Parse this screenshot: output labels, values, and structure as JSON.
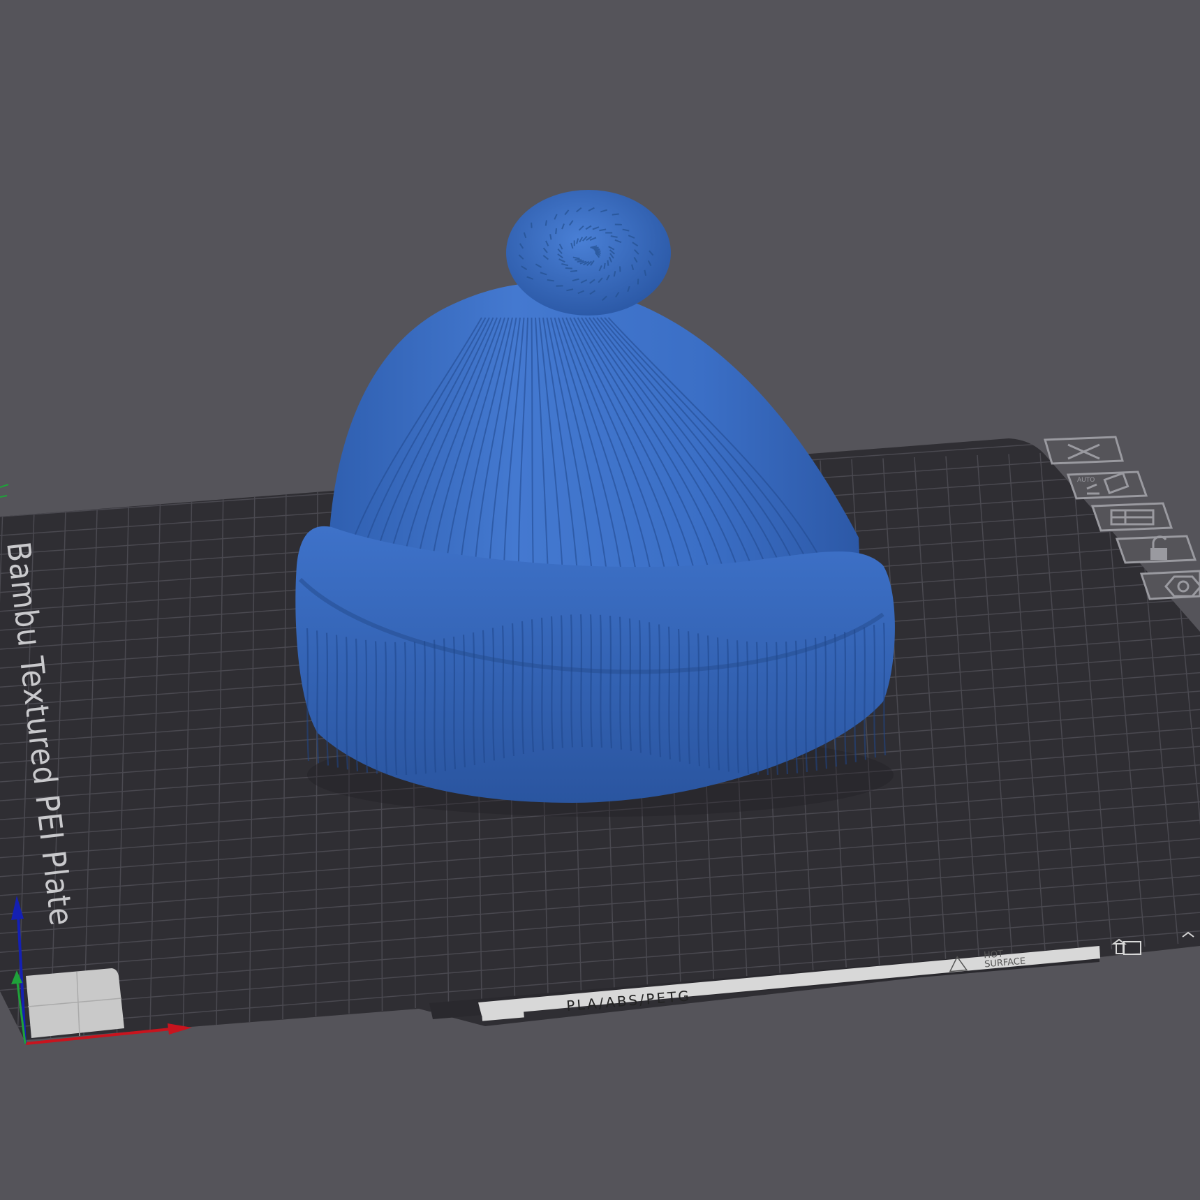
{
  "viewport": {
    "background_color": "#55545a",
    "plate_color": "#2f2e33",
    "grid_color": "#4a4950",
    "model_color": "#3b6fc6"
  },
  "plate": {
    "name_label": "Bambu Textured PEI Plate",
    "material_strip": {
      "text": "PLA/ABS/PETG",
      "warning": "HOT\nSURFACE",
      "warning_line1": "HOT",
      "warning_line2": "SURFACE"
    },
    "side_toolbar": [
      {
        "name": "close-plate-icon",
        "label": ""
      },
      {
        "name": "auto-arrange-icon",
        "label": "AUTO"
      },
      {
        "name": "orient-layout-icon",
        "label": ""
      },
      {
        "name": "lock-plate-icon",
        "label": ""
      },
      {
        "name": "plate-settings-icon",
        "label": ""
      }
    ]
  },
  "model": {
    "name": "beanie-hat",
    "color": "#3b6fc6"
  },
  "axes": {
    "x_color": "#c8141e",
    "y_color": "#1fa23a",
    "z_color": "#1420b4"
  }
}
